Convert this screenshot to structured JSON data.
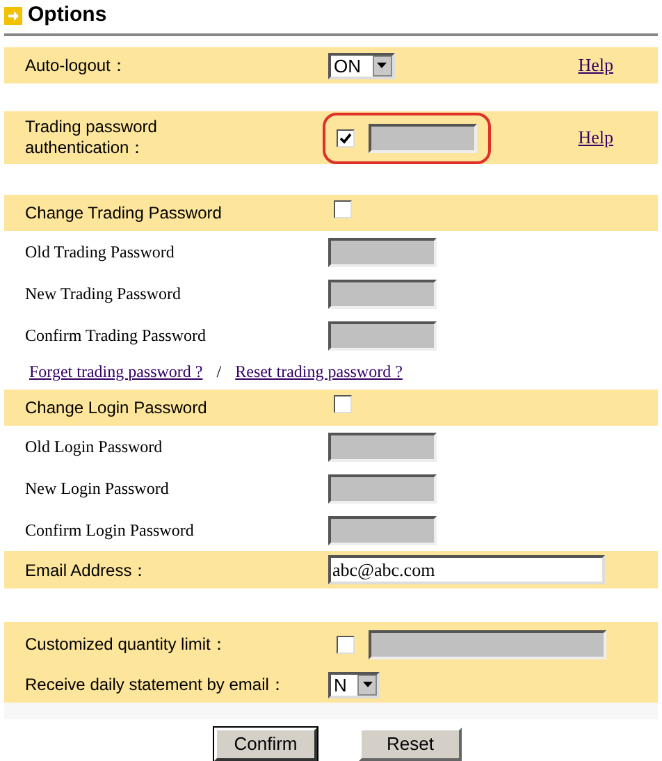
{
  "title": "Options",
  "groups": [
    [
      {
        "kind": "select",
        "label": "Auto-logout：",
        "value": "ON",
        "help": "Help"
      }
    ],
    [
      {
        "kind": "checkbox-field",
        "label": "Trading password authentication：",
        "checked": true,
        "outlined": true,
        "help": "Help"
      }
    ],
    [
      {
        "kind": "checkbox",
        "label": "Change Trading Password",
        "checked": false
      },
      {
        "kind": "password",
        "label": "Old Trading Password"
      },
      {
        "kind": "password",
        "label": "New Trading Password"
      },
      {
        "kind": "password",
        "label": "Confirm Trading Password"
      },
      {
        "kind": "links",
        "links": [
          "Forget trading password ?",
          "Reset trading password ?"
        ],
        "separator": "/"
      },
      {
        "kind": "checkbox",
        "label": "Change Login Password",
        "checked": false
      },
      {
        "kind": "password",
        "label": "Old Login Password"
      },
      {
        "kind": "password",
        "label": "New Login Password"
      },
      {
        "kind": "password",
        "label": "Confirm Login Password"
      },
      {
        "kind": "text",
        "label": "Email Address：",
        "value": "abc@abc.com"
      }
    ],
    [
      {
        "kind": "checkbox-field",
        "label": "Customized quantity limit：",
        "checked": false,
        "outlined": false
      },
      {
        "kind": "select",
        "label": "Receive daily statement by email：",
        "value": "N"
      }
    ]
  ],
  "buttons": [
    "Confirm",
    "Reset"
  ]
}
